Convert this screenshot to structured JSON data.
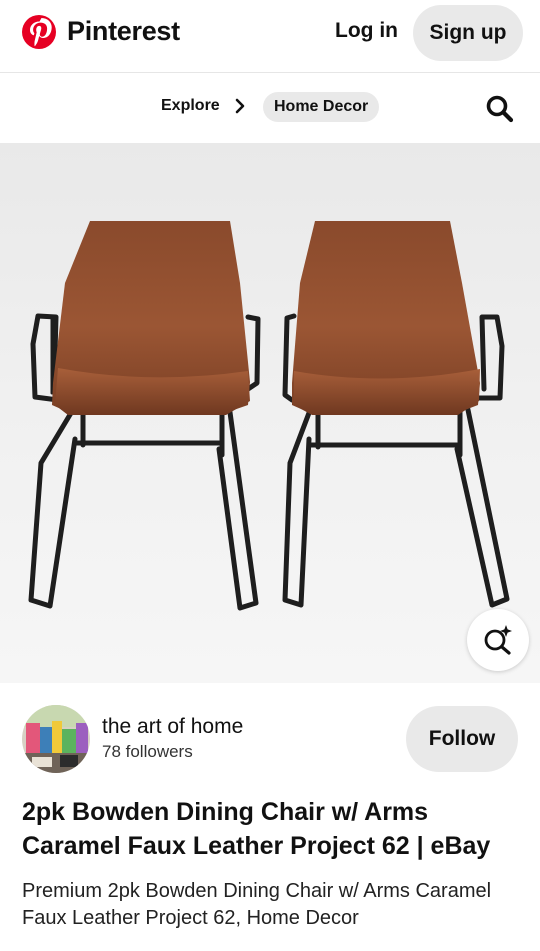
{
  "header": {
    "brand": "Pinterest",
    "login_label": "Log in",
    "signup_label": "Sign up",
    "brand_color": "#E60023"
  },
  "nav": {
    "explore_label": "Explore",
    "category_label": "Home Decor"
  },
  "pin": {
    "image_alt": "Two caramel faux leather dining chairs with black metal frames",
    "chair_color": "#8B4A2A",
    "frame_color": "#1e1e1e"
  },
  "creator": {
    "name": "the art of home",
    "followers": "78 followers",
    "follow_label": "Follow"
  },
  "details": {
    "title": "2pk Bowden Dining Chair w/ Arms Caramel Faux Leather Project 62 | eBay",
    "description": "Premium 2pk Bowden Dining Chair w/ Arms Caramel Faux Leather Project 62, Home Decor"
  }
}
